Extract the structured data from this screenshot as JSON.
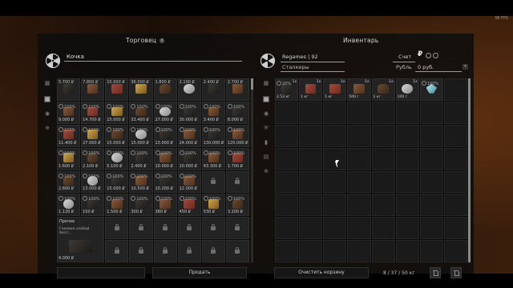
{
  "fps": "38 FPS",
  "trader": {
    "title": "Торговец",
    "name": "Кочка",
    "rows": [
      {
        "type": "price",
        "cells": [
          "5.700 ₽",
          "7.800 ₽",
          "15.000 ₽",
          "36.000 ₽",
          "1.800 ₽",
          "2.100 ₽",
          "2.400 ₽",
          "2.700 ₽"
        ]
      },
      {
        "type": "price",
        "cells": [
          "9.000 ₽",
          "14.700 ₽",
          "15.000 ₽",
          "33.400 ₽",
          "27.000 ₽",
          "30.000 ₽",
          "3.400 ₽",
          "8.000 ₽"
        ]
      },
      {
        "type": "price",
        "cells": [
          "11.400 ₽",
          "27.000 ₽",
          "15.000 ₽",
          "15.000 ₽",
          "13.000 ₽",
          "24.000 ₽",
          "130.000 ₽",
          "120.000 ₽"
        ]
      },
      {
        "type": "price",
        "cells": [
          "1.600 ₽",
          "2.100 ₽",
          "5.100 ₽",
          "2.400 ₽",
          "10.000 ₽",
          "10.000 ₽",
          "43.300 ₽",
          "1.700 ₽"
        ]
      },
      {
        "type": "price",
        "cells": [
          "2.800 ₽",
          "13.000 ₽",
          "15.000 ₽",
          "10.500 ₽",
          "10.200 ₽",
          "12.000 ₽",
          "",
          ""
        ]
      },
      {
        "type": "price",
        "cells": [
          "1.120 ₽",
          "100 ₽",
          "1.500 ₽",
          "300 ₽",
          "380 ₽",
          "450 ₽",
          "530 ₽",
          "3.200 ₽"
        ]
      }
    ],
    "pct_label": "100%",
    "misc": {
      "label": "Прочее",
      "desc": "Гелевая слабой бесп...",
      "price": "4.000 ₽"
    },
    "sell_button": "Продать"
  },
  "inventory": {
    "title": "Инвентарь",
    "player": "Regames | 92",
    "faction": "Сталкеры",
    "account_label": "Счет",
    "currency": "Рубль",
    "balance": "0 руб.",
    "items": [
      {
        "pct": "20%",
        "qty": "1x",
        "weight": "2.53 кг",
        "kind": "darkbox"
      },
      {
        "pct": "",
        "qty": "1x",
        "weight": "1 кг",
        "kind": "redbox"
      },
      {
        "pct": "",
        "qty": "1x",
        "weight": "1 кг",
        "kind": "redbox"
      },
      {
        "pct": "",
        "qty": "1x",
        "weight": "500 г",
        "kind": "brownbox"
      },
      {
        "pct": "",
        "qty": "1x",
        "weight": "1 кг",
        "kind": "bag"
      },
      {
        "pct": "",
        "qty": "1x",
        "weight": "100 г",
        "kind": "silver"
      },
      {
        "pct": "100%",
        "qty": "",
        "weight": "",
        "kind": "crystal"
      }
    ],
    "clear_button": "Очистить корзину",
    "weight": "8 / 37 / 50 кг"
  },
  "icons": {
    "ruble": "₽",
    "dropdown": "▾"
  }
}
